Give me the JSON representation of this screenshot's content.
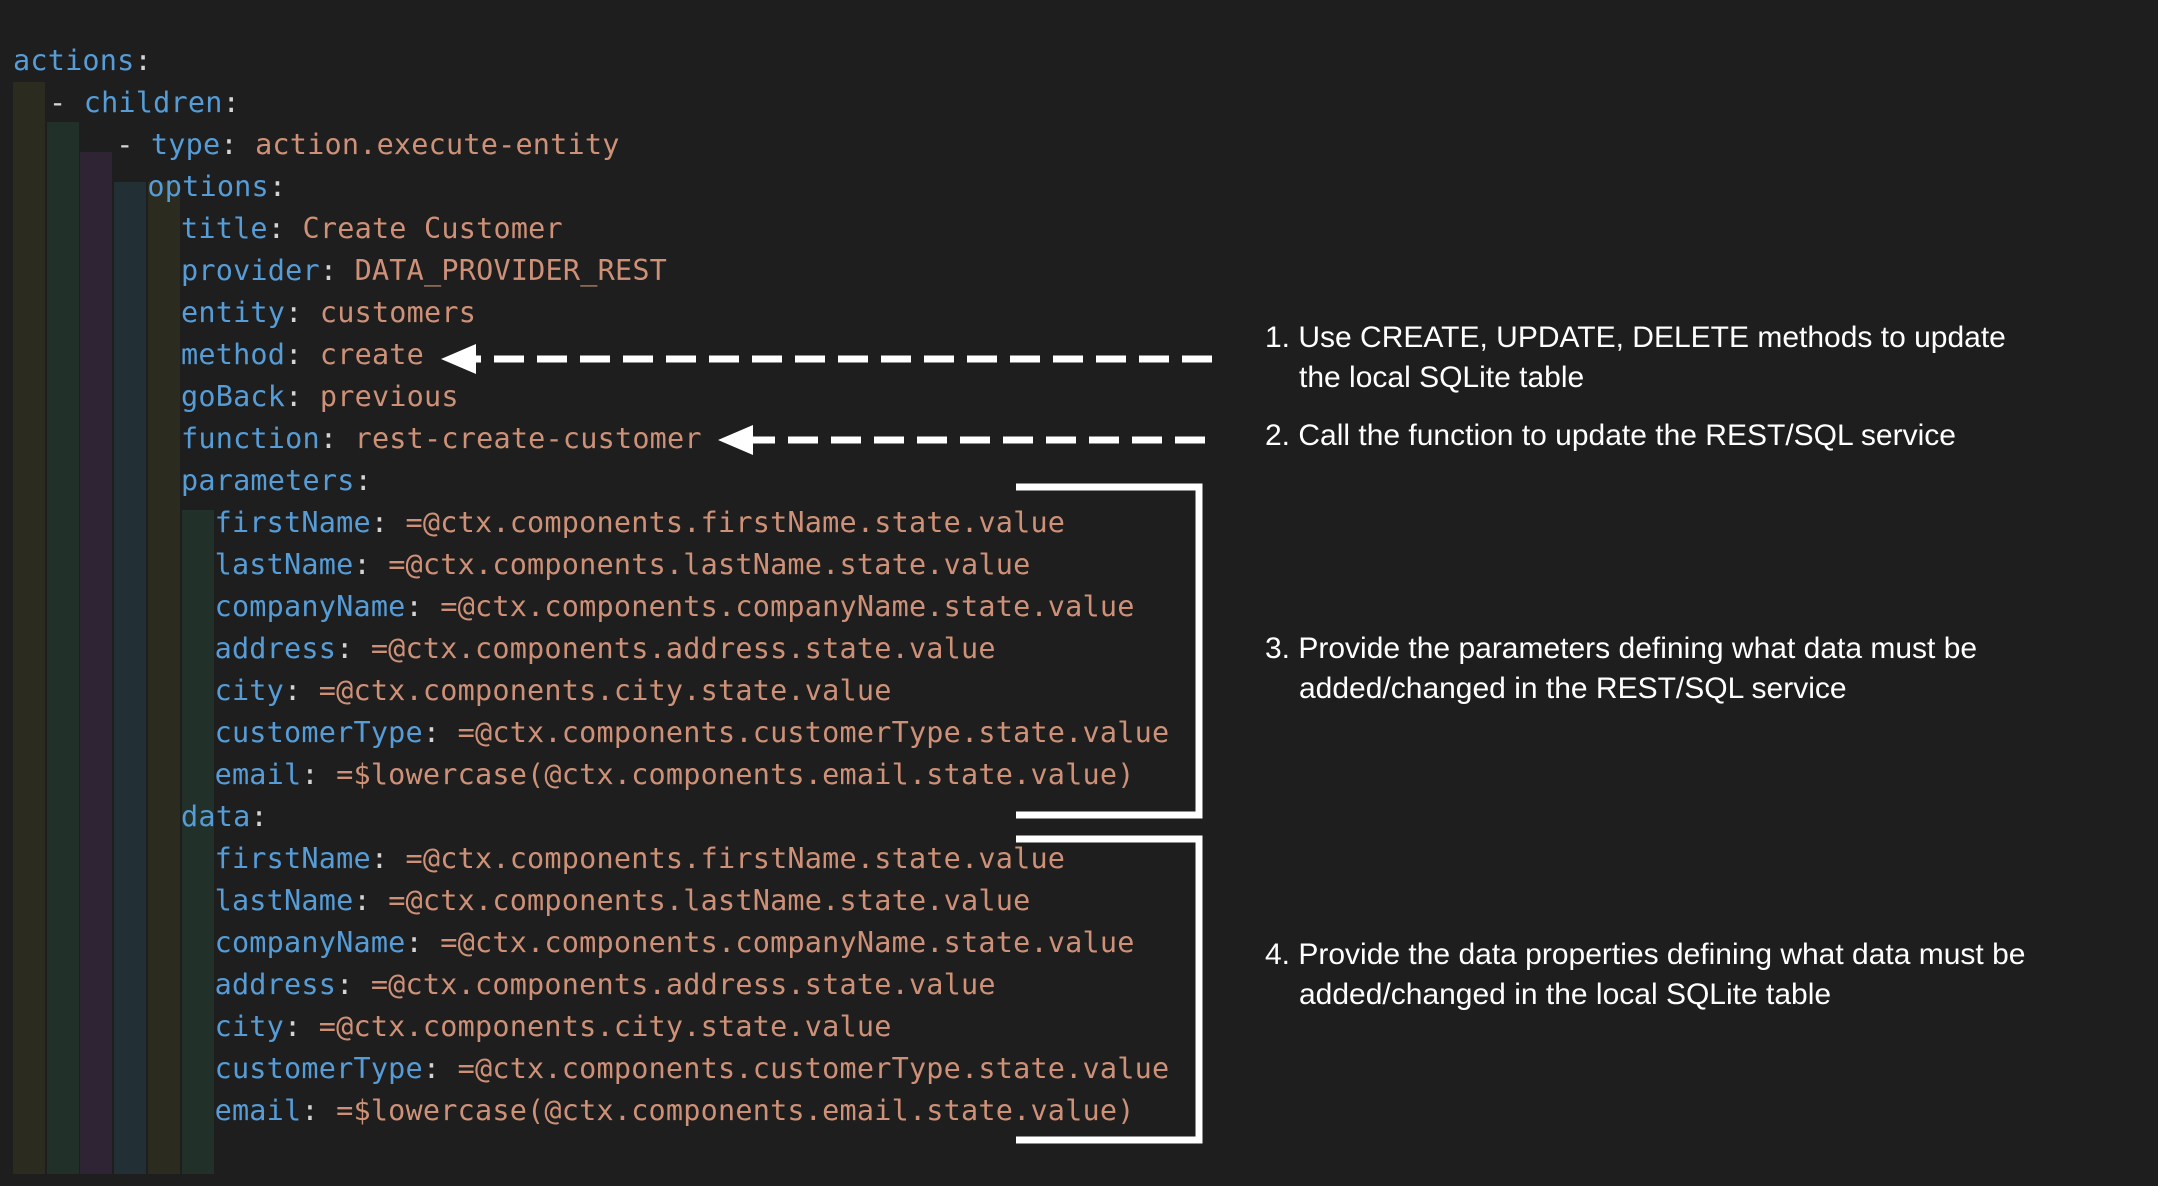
{
  "colors": {
    "background": "#1e1e1e",
    "key": "#569cd6",
    "value": "#ce9178",
    "punctuation": "#d4d4d4",
    "annotation": "#ffffff",
    "indent_guides": [
      "#2b2b20",
      "#22302a",
      "#2f2433",
      "#223036",
      "#2b2b20",
      "#22302a"
    ]
  },
  "code": {
    "lines": [
      {
        "dash": "",
        "key": "actions",
        "colon": ":",
        "value": ""
      },
      {
        "dash": "- ",
        "key": "children",
        "colon": ":",
        "value": ""
      },
      {
        "dash": "- ",
        "key": "type",
        "colon": ": ",
        "value": "action.execute-entity"
      },
      {
        "dash": "",
        "key": "options",
        "colon": ":",
        "value": ""
      },
      {
        "dash": "",
        "key": "title",
        "colon": ": ",
        "value": "Create Customer"
      },
      {
        "dash": "",
        "key": "provider",
        "colon": ": ",
        "value": "DATA_PROVIDER_REST"
      },
      {
        "dash": "",
        "key": "entity",
        "colon": ": ",
        "value": "customers"
      },
      {
        "dash": "",
        "key": "method",
        "colon": ": ",
        "value": "create"
      },
      {
        "dash": "",
        "key": "goBack",
        "colon": ": ",
        "value": "previous"
      },
      {
        "dash": "",
        "key": "function",
        "colon": ": ",
        "value": "rest-create-customer"
      },
      {
        "dash": "",
        "key": "parameters",
        "colon": ":",
        "value": ""
      },
      {
        "dash": "",
        "key": "firstName",
        "colon": ": ",
        "value": "=@ctx.components.firstName.state.value"
      },
      {
        "dash": "",
        "key": "lastName",
        "colon": ": ",
        "value": "=@ctx.components.lastName.state.value"
      },
      {
        "dash": "",
        "key": "companyName",
        "colon": ": ",
        "value": "=@ctx.components.companyName.state.value"
      },
      {
        "dash": "",
        "key": "address",
        "colon": ": ",
        "value": "=@ctx.components.address.state.value"
      },
      {
        "dash": "",
        "key": "city",
        "colon": ": ",
        "value": "=@ctx.components.city.state.value"
      },
      {
        "dash": "",
        "key": "customerType",
        "colon": ": ",
        "value": "=@ctx.components.customerType.state.value"
      },
      {
        "dash": "",
        "key": "email",
        "colon": ": ",
        "value": "=$lowercase(@ctx.components.email.state.value)"
      },
      {
        "dash": "",
        "key": "data",
        "colon": ":",
        "value": ""
      },
      {
        "dash": "",
        "key": "firstName",
        "colon": ": ",
        "value": "=@ctx.components.firstName.state.value"
      },
      {
        "dash": "",
        "key": "lastName",
        "colon": ": ",
        "value": "=@ctx.components.lastName.state.value"
      },
      {
        "dash": "",
        "key": "companyName",
        "colon": ": ",
        "value": "=@ctx.components.companyName.state.value"
      },
      {
        "dash": "",
        "key": "address",
        "colon": ": ",
        "value": "=@ctx.components.address.state.value"
      },
      {
        "dash": "",
        "key": "city",
        "colon": ": ",
        "value": "=@ctx.components.city.state.value"
      },
      {
        "dash": "",
        "key": "customerType",
        "colon": ": ",
        "value": "=@ctx.components.customerType.state.value"
      },
      {
        "dash": "",
        "key": "email",
        "colon": ": ",
        "value": "=$lowercase(@ctx.components.email.state.value)"
      }
    ]
  },
  "annotations": [
    {
      "line1": "1. Use CREATE, UPDATE, DELETE methods to update",
      "line2": "the local SQLite table"
    },
    {
      "line1": "2. Call the function to update the REST/SQL service",
      "line2": ""
    },
    {
      "line1": "3. Provide the parameters defining what data must be",
      "line2": "added/changed in the REST/SQL service"
    },
    {
      "line1": "4. Provide the data properties defining what data must be",
      "line2": "added/changed in the local SQLite table"
    }
  ]
}
